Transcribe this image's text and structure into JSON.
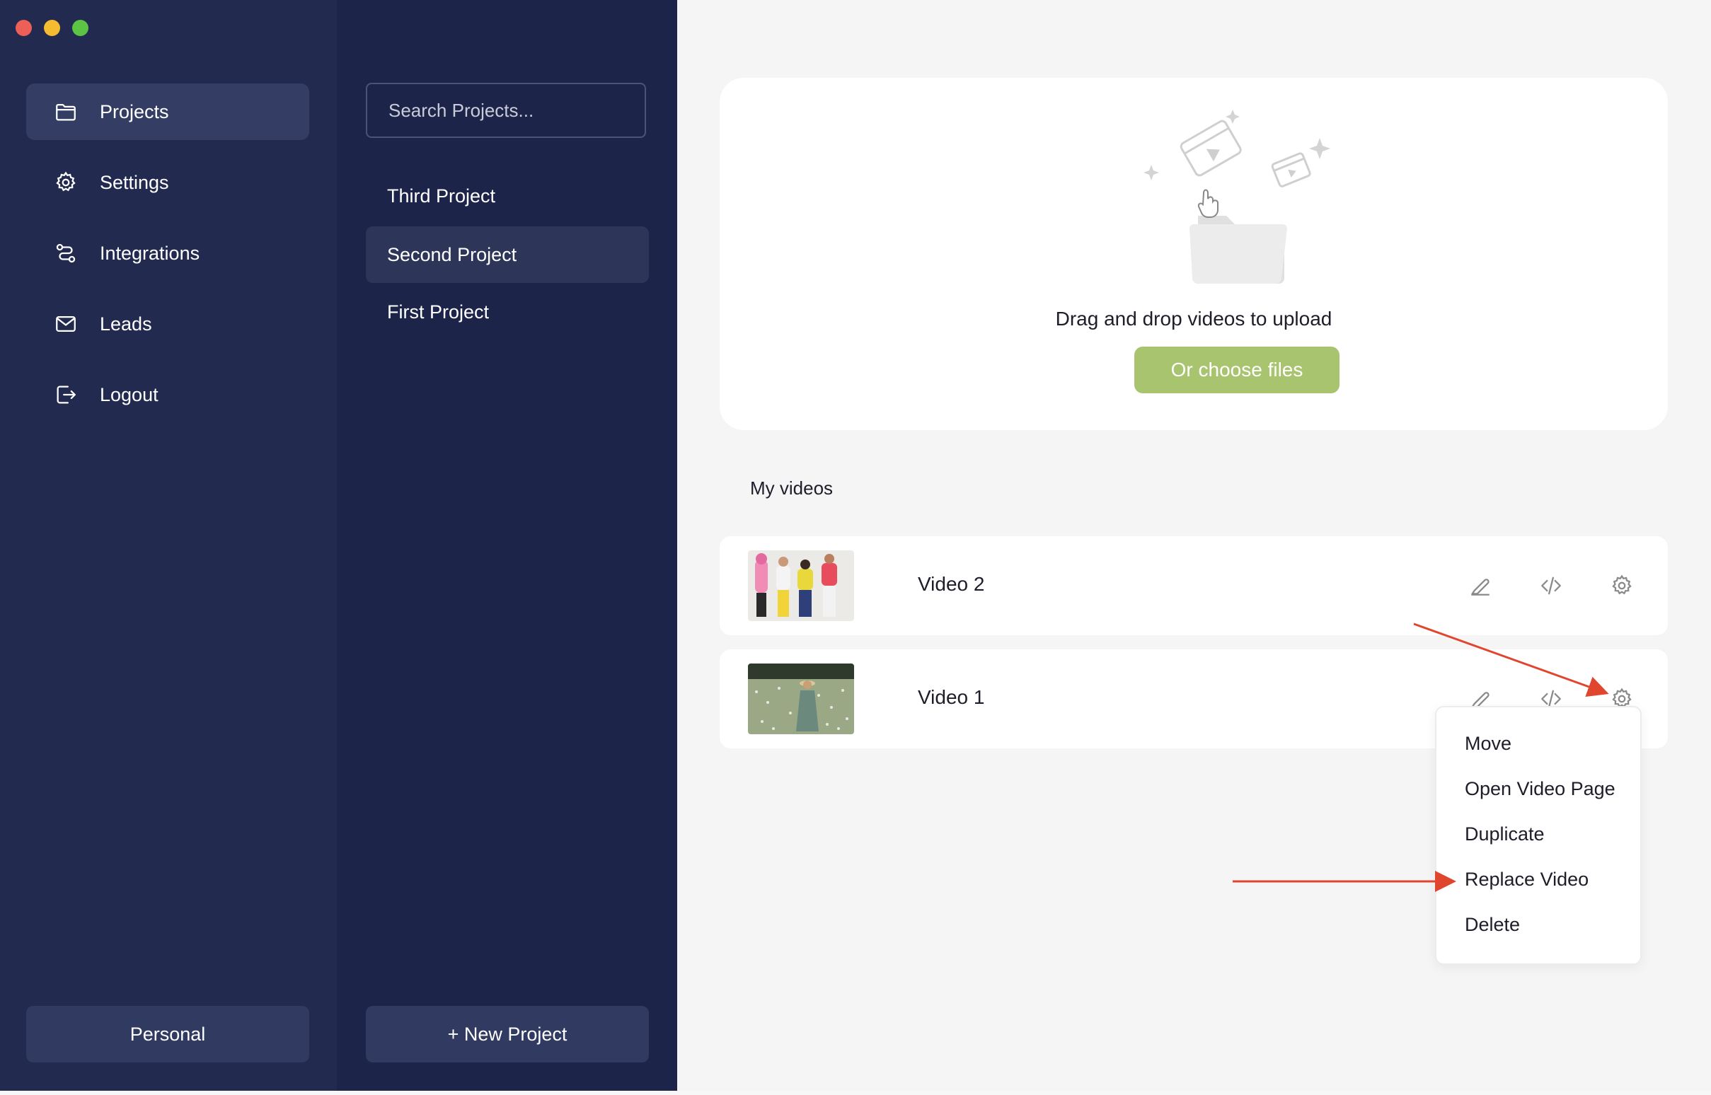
{
  "window": {
    "controls": {
      "close_color": "#ee5f57",
      "minimize_color": "#f5bc30",
      "zoom_color": "#5cc344"
    }
  },
  "nav": {
    "items": [
      {
        "label": "Projects",
        "icon": "folder-icon",
        "active": true
      },
      {
        "label": "Settings",
        "icon": "gear-icon",
        "active": false
      },
      {
        "label": "Integrations",
        "icon": "integrations-icon",
        "active": false
      },
      {
        "label": "Leads",
        "icon": "mail-icon",
        "active": false
      },
      {
        "label": "Logout",
        "icon": "logout-icon",
        "active": false
      }
    ],
    "workspace_label": "Personal"
  },
  "projects": {
    "search_placeholder": "Search Projects...",
    "items": [
      {
        "label": "Third Project",
        "active": false
      },
      {
        "label": "Second Project",
        "active": true
      },
      {
        "label": "First Project",
        "active": false
      }
    ],
    "new_project_label": "+ New Project"
  },
  "upload": {
    "drag_text": "Drag and drop videos to upload",
    "choose_label": "Or choose files",
    "accent": "#a8c46f"
  },
  "videos": {
    "section_title": "My videos",
    "items": [
      {
        "title": "Video 2",
        "thumb": "people-thumbnail"
      },
      {
        "title": "Video 1",
        "thumb": "field-thumbnail"
      }
    ]
  },
  "context_menu": {
    "items": [
      "Move",
      "Open Video Page",
      "Duplicate",
      "Replace Video",
      "Delete"
    ]
  },
  "annotation": {
    "arrow_color": "#e0462e"
  }
}
